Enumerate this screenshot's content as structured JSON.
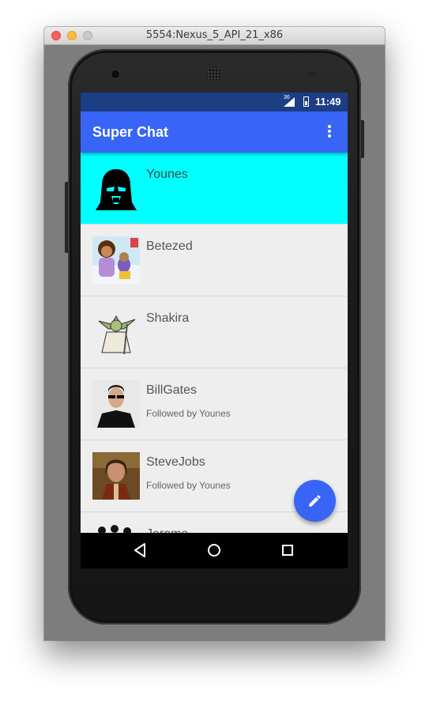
{
  "window": {
    "title": "5554:Nexus_5_API_21_x86"
  },
  "status_bar": {
    "network": "36",
    "time": "11:49"
  },
  "app_bar": {
    "title": "Super Chat",
    "menu_icon": "more-vert-icon"
  },
  "contacts": [
    {
      "name": "Younes",
      "subtitle": "",
      "selected": true,
      "avatar": "darth-vader-avatar"
    },
    {
      "name": "Betezed",
      "subtitle": "",
      "selected": false,
      "avatar": "dora-avatar"
    },
    {
      "name": "Shakira",
      "subtitle": "",
      "selected": false,
      "avatar": "yoda-avatar"
    },
    {
      "name": "BillGates",
      "subtitle": "Followed by Younes",
      "selected": false,
      "avatar": "neo-avatar"
    },
    {
      "name": "SteveJobs",
      "subtitle": "Followed by Younes",
      "selected": false,
      "avatar": "hobbit-avatar"
    },
    {
      "name": "Jerome",
      "subtitle": "",
      "selected": false,
      "avatar": "jerome-avatar"
    }
  ],
  "fab": {
    "icon": "edit-pencil-icon"
  },
  "nav_bar": {
    "back": "back-icon",
    "home": "home-icon",
    "recents": "recents-icon"
  },
  "colors": {
    "primary": "#3865f5",
    "status_bar": "#1b3e84",
    "selected_row": "#00ffff",
    "list_bg": "#eeeeee"
  }
}
